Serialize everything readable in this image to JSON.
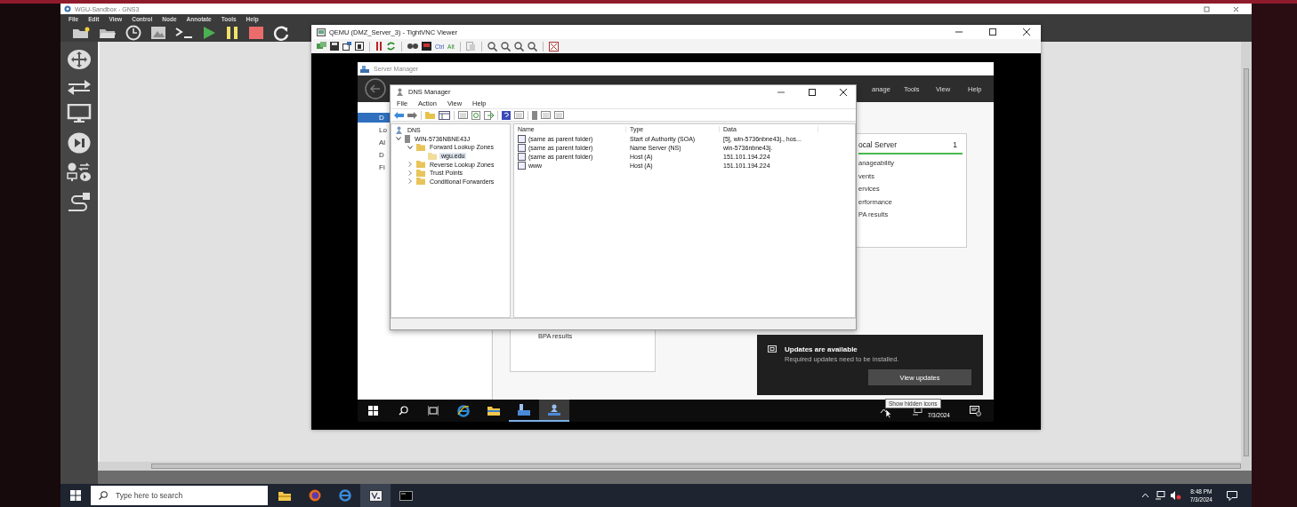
{
  "gns3": {
    "title": "WGU-Sandbox - GNS3",
    "menu": [
      "File",
      "Edit",
      "View",
      "Control",
      "Node",
      "Annotate",
      "Tools",
      "Help"
    ]
  },
  "vnc": {
    "title": "QEMU (DMZ_Server_3) - TightVNC Viewer",
    "toolbar_keys": [
      "Ctrl",
      "Alt"
    ]
  },
  "server_manager": {
    "title": "Server Manager",
    "header_menu": [
      "anage",
      "Tools",
      "View",
      "Help"
    ],
    "nav": [
      {
        "label": "D",
        "selected": true
      },
      {
        "label": "Lo",
        "selected": false
      },
      {
        "label": "Al",
        "selected": false
      },
      {
        "label": "D",
        "selected": false
      },
      {
        "label": "Fi",
        "selected": false
      }
    ],
    "tile": {
      "title": "ocal Server",
      "count": "1",
      "items": [
        "anageability",
        "vents",
        "ervices",
        "erformance",
        "PA results"
      ]
    },
    "lower_tile": {
      "items": [
        "BPA results"
      ]
    }
  },
  "dns_manager": {
    "title": "DNS Manager",
    "menu": [
      "File",
      "Action",
      "View",
      "Help"
    ],
    "tree": [
      {
        "label": "DNS",
        "selected": false,
        "children": [
          {
            "label": "WIN-5736NBNE43J",
            "expanded": true,
            "selected": false,
            "children": [
              {
                "label": "Forward Lookup Zones",
                "expanded": true,
                "selected": false,
                "children": [
                  {
                    "label": "wgu.edu",
                    "selected": true
                  }
                ]
              },
              {
                "label": "Reverse Lookup Zones",
                "expanded": false,
                "selected": false
              },
              {
                "label": "Trust Points",
                "expanded": false,
                "selected": false
              },
              {
                "label": "Conditional Forwarders",
                "expanded": false,
                "selected": false
              }
            ]
          }
        ]
      }
    ],
    "columns": [
      "Name",
      "Type",
      "Data"
    ],
    "rows": [
      {
        "name": "(same as parent folder)",
        "type": "Start of Authority (SOA)",
        "data": "[5], win-5736nbne43j., hos..."
      },
      {
        "name": "(same as parent folder)",
        "type": "Name Server (NS)",
        "data": "win-5736nbne43j."
      },
      {
        "name": "(same as parent folder)",
        "type": "Host (A)",
        "data": "151.101.194.224"
      },
      {
        "name": "www",
        "type": "Host (A)",
        "data": "151.101.194.224"
      }
    ]
  },
  "notification": {
    "title": "Updates are available",
    "message": "Required updates need to be installed.",
    "button": "View updates"
  },
  "vm_taskbar": {
    "tooltip": "Show hidden icons",
    "date": "7/3/2024"
  },
  "host_taskbar": {
    "search": {
      "placeholder": "Type here to search"
    },
    "time": "8:48 PM",
    "date": "7/3/2024"
  }
}
